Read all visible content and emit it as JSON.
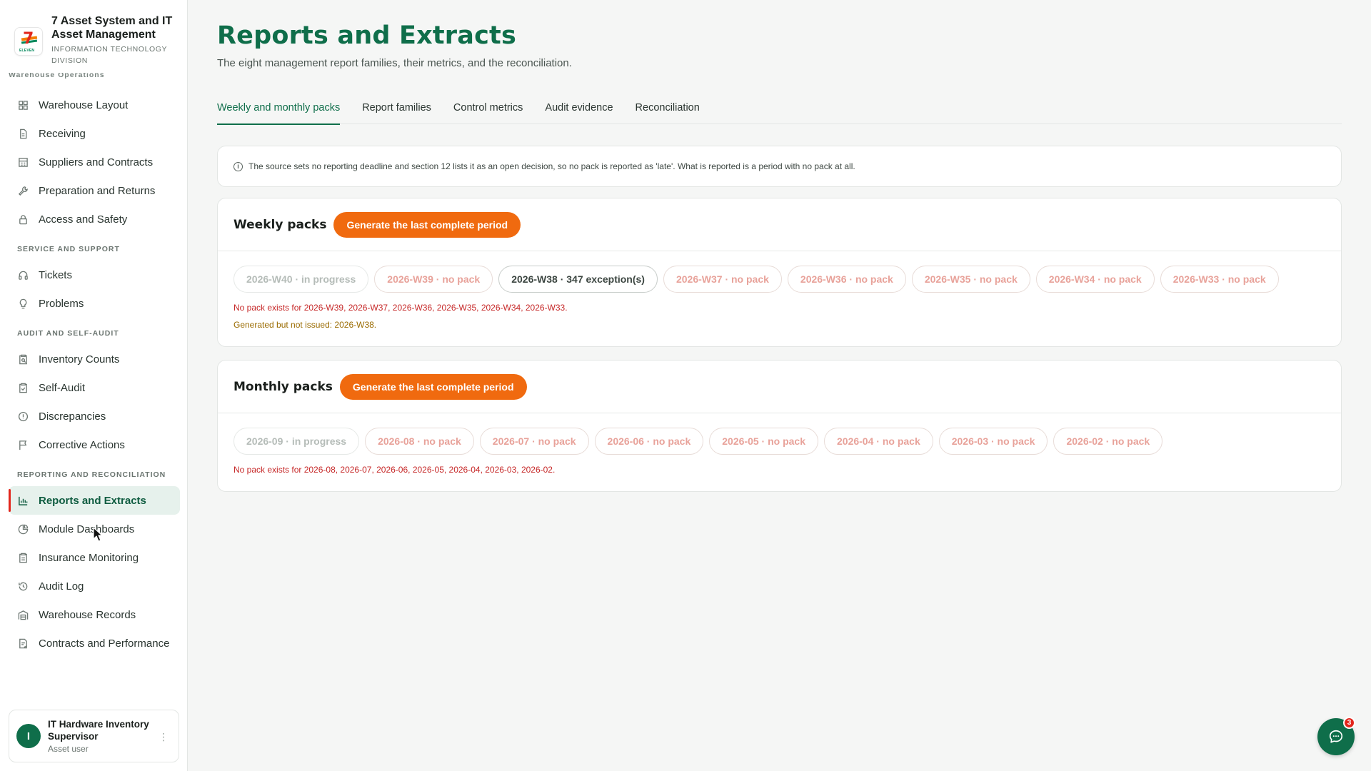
{
  "brand": {
    "title": "7 Asset System and IT Asset Management",
    "subtitle": "Information Technology Division",
    "logo_text": "7",
    "logo_mini": "ELEVEN"
  },
  "sidebar": {
    "cut_section": "Warehouse Operations",
    "group1": [
      {
        "label": "Warehouse Layout",
        "icon": "grid-icon"
      },
      {
        "label": "Receiving",
        "icon": "document-icon"
      },
      {
        "label": "Suppliers and Contracts",
        "icon": "building-icon"
      },
      {
        "label": "Preparation and Returns",
        "icon": "wrench-icon"
      },
      {
        "label": "Access and Safety",
        "icon": "lock-icon"
      }
    ],
    "section2": "Service and Support",
    "group2": [
      {
        "label": "Tickets",
        "icon": "headset-icon"
      },
      {
        "label": "Problems",
        "icon": "lightbulb-icon"
      }
    ],
    "section3": "Audit and Self-Audit",
    "group3": [
      {
        "label": "Inventory Counts",
        "icon": "clipboard-search-icon"
      },
      {
        "label": "Self-Audit",
        "icon": "clipboard-check-icon"
      },
      {
        "label": "Discrepancies",
        "icon": "alert-circle-icon"
      },
      {
        "label": "Corrective Actions",
        "icon": "flag-icon"
      }
    ],
    "section4": "Reporting and Reconciliation",
    "group4": [
      {
        "label": "Reports and Extracts",
        "icon": "bar-chart-icon"
      },
      {
        "label": "Module Dashboards",
        "icon": "pie-chart-icon"
      },
      {
        "label": "Insurance Monitoring",
        "icon": "clipboard-icon"
      },
      {
        "label": "Audit Log",
        "icon": "history-icon"
      },
      {
        "label": "Warehouse Records",
        "icon": "warehouse-icon"
      },
      {
        "label": "Contracts and Performance",
        "icon": "contract-icon"
      }
    ]
  },
  "user": {
    "initial": "I",
    "name": "IT Hardware Inventory Supervisor",
    "role": "Asset user"
  },
  "page": {
    "title": "Reports and Extracts",
    "subtitle": "The eight management report families, their metrics, and the reconciliation."
  },
  "tabs": [
    "Weekly and monthly packs",
    "Report families",
    "Control metrics",
    "Audit evidence",
    "Reconciliation"
  ],
  "notice": "The source sets no reporting deadline and section 12 lists it as an open decision, so no pack is reported as 'late'. What is reported is a period with no pack at all.",
  "weekly": {
    "title": "Weekly packs",
    "button": "Generate the last complete period",
    "pills": [
      "2026-W40 · in progress",
      "2026-W39 · no pack",
      "2026-W38 · 347 exception(s)",
      "2026-W37 · no pack",
      "2026-W36 · no pack",
      "2026-W35 · no pack",
      "2026-W34 · no pack",
      "2026-W33 · no pack"
    ],
    "missing_note": "No pack exists for 2026-W39, 2026-W37, 2026-W36, 2026-W35, 2026-W34, 2026-W33.",
    "not_issued_note": "Generated but not issued: 2026-W38."
  },
  "monthly": {
    "title": "Monthly packs",
    "button": "Generate the last complete period",
    "pills": [
      "2026-09 · in progress",
      "2026-08 · no pack",
      "2026-07 · no pack",
      "2026-06 · no pack",
      "2026-05 · no pack",
      "2026-04 · no pack",
      "2026-03 · no pack",
      "2026-02 · no pack"
    ],
    "missing_note": "No pack exists for 2026-08, 2026-07, 2026-06, 2026-05, 2026-04, 2026-03, 2026-02."
  },
  "chat": {
    "badge": "3"
  },
  "colors": {
    "brand_green": "#0f6e4a",
    "accent_orange": "#f06a0f",
    "alert_red": "#c62828"
  }
}
